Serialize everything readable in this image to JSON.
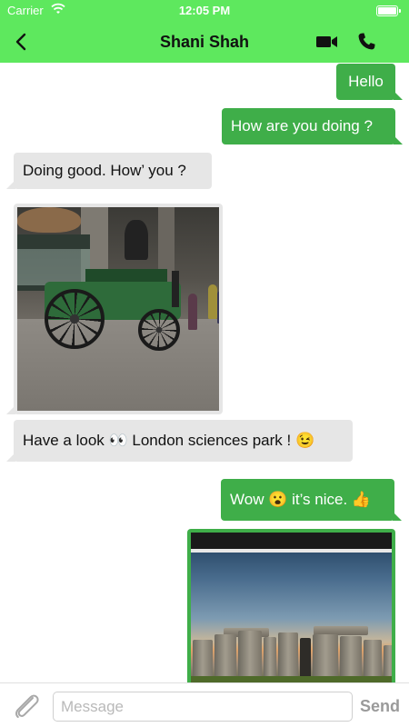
{
  "status_bar": {
    "carrier": "Carrier",
    "time": "12:05 PM"
  },
  "header": {
    "title": "Shani Shah",
    "back_icon": "chevron-left-icon",
    "video_icon": "video-camera-icon",
    "call_icon": "phone-icon",
    "background_color": "#5ee85e"
  },
  "messages": [
    {
      "direction": "out",
      "type": "text",
      "text": "Hello"
    },
    {
      "direction": "out",
      "type": "text",
      "text": "How are you doing ?"
    },
    {
      "direction": "in",
      "type": "text",
      "text": "Doing good. How’ you ?"
    },
    {
      "direction": "in",
      "type": "image",
      "subject": "museum-steam-engine-photo"
    },
    {
      "direction": "in",
      "type": "text",
      "text": "Have a look 👀 London sciences park ! 😉"
    },
    {
      "direction": "out",
      "type": "text",
      "text": "Wow 😮 it’s nice. 👍"
    },
    {
      "direction": "out",
      "type": "image",
      "subject": "stonehenge-photo"
    }
  ],
  "input_bar": {
    "attach_icon": "paperclip-icon",
    "placeholder": "Message",
    "value": "",
    "send_label": "Send"
  },
  "colors": {
    "outgoing_bubble": "#3fae49",
    "incoming_bubble": "#e6e6e6",
    "accent": "#5ee85e"
  }
}
